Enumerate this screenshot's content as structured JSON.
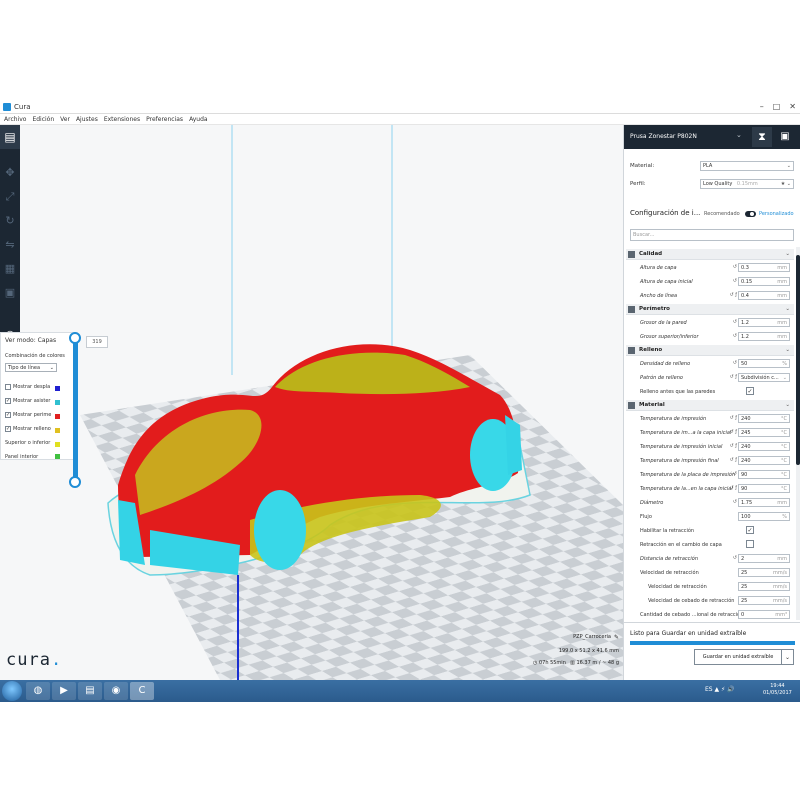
{
  "window": {
    "title": "Cura",
    "controls": [
      "–",
      "□",
      "✕"
    ]
  },
  "menu": [
    "Archivo",
    "Edición",
    "Ver",
    "Ajustes",
    "Extensiones",
    "Preferencias",
    "Ayuda"
  ],
  "view_panel": {
    "mode_label": "Ver modo: Capas",
    "color_scheme_label": "Combinación de colores",
    "color_scheme_value": "Tipo de línea",
    "options": [
      {
        "label": "Mostrar despla",
        "checked": false,
        "color": "#2020d0"
      },
      {
        "label": "Mostrar asister",
        "checked": true,
        "color": "#30c0d0"
      },
      {
        "label": "Mostrar perime",
        "checked": true,
        "color": "#e02020"
      },
      {
        "label": "Mostrar relleno",
        "checked": true,
        "color": "#e0c020"
      },
      {
        "label": "Superior o inferior",
        "checked": null,
        "color": "#e0e020"
      },
      {
        "label": "Panel interior",
        "checked": null,
        "color": "#40c040"
      }
    ],
    "layer_value": "319"
  },
  "sidebar": {
    "printer": "Prusa Zonestar P802N",
    "material_label": "Material:",
    "material_value": "PLA",
    "profile_label": "Perfil:",
    "profile_value": "Low Quality",
    "profile_sub": "0.15mm",
    "config_title": "Configuración de i...",
    "mode_recommended": "Recomendado",
    "mode_custom": "Personalizado",
    "search_placeholder": "Buscar...",
    "ready_text": "Listo para Guardar en unidad extraíble",
    "ready_progress": 1.0,
    "save_button": "Guardar en unidad extraíble",
    "save_dropdown": "⌄"
  },
  "categories": {
    "calidad": "Calidad",
    "perimetro": "Perímetro",
    "relleno": "Relleno",
    "material": "Material"
  },
  "settings": {
    "altura_capa": {
      "label": "Altura de capa",
      "value": "0.3",
      "unit": "mm"
    },
    "altura_capa_inicial": {
      "label": "Altura de capa inicial",
      "value": "0.15",
      "unit": "mm"
    },
    "ancho_linea": {
      "label": "Ancho de línea",
      "value": "0.4",
      "unit": "mm"
    },
    "grosor_pared": {
      "label": "Grosor de la pared",
      "value": "1.2",
      "unit": "mm"
    },
    "grosor_superior": {
      "label": "Grosor superior/inferior",
      "value": "1.2",
      "unit": "mm"
    },
    "densidad_relleno": {
      "label": "Densidad de relleno",
      "value": "50",
      "unit": "%"
    },
    "patron_relleno": {
      "label": "Patrón de relleno",
      "value": "Subdivisión c..."
    },
    "relleno_antes": {
      "label": "Relleno antes que las paredes",
      "checked": true
    },
    "temp_impresion": {
      "label": "Temperatura de impresión",
      "value": "240",
      "unit": "°C"
    },
    "temp_capa_inicial": {
      "label": "Temperatura de im...a la capa inicial",
      "value": "245",
      "unit": "°C"
    },
    "temp_impresion_inicial": {
      "label": "Temperatura de impresión inicial",
      "value": "240",
      "unit": "°C"
    },
    "temp_impresion_final": {
      "label": "Temperatura de impresión final",
      "value": "240",
      "unit": "°C"
    },
    "temp_placa": {
      "label": "Temperatura de la placa de impresión",
      "value": "90",
      "unit": "°C"
    },
    "temp_placa_inicial": {
      "label": "Temperatura de la...en la capa inicial",
      "value": "90",
      "unit": "°C"
    },
    "diametro": {
      "label": "Diámetro",
      "value": "1.75",
      "unit": "mm"
    },
    "flujo": {
      "label": "Flujo",
      "value": "100",
      "unit": "%"
    },
    "habilitar_retraccion": {
      "label": "Habilitar la retracción",
      "checked": true
    },
    "retraccion_cambio": {
      "label": "Retracción en el cambio de capa",
      "checked": false
    },
    "distancia_retraccion": {
      "label": "Distancia de retracción",
      "value": "2",
      "unit": "mm"
    },
    "velocidad_retraccion": {
      "label": "Velocidad de retracción",
      "value": "25",
      "unit": "mm/s"
    },
    "velocidad_retraccion_2": {
      "label": "Velocidad de retracción",
      "value": "25",
      "unit": "mm/s"
    },
    "velocidad_cebado": {
      "label": "Velocidad de cebado de retracción",
      "value": "25",
      "unit": "mm/s"
    },
    "cantidad_cebado": {
      "label": "Cantidad de cebado ...ional de retracción",
      "value": "0",
      "unit": "mm³"
    }
  },
  "job": {
    "name": "PZP_Carroceria",
    "dimensions": "199.0 x 51.2 x 41.6 mm",
    "time": "07h 55min",
    "material": "16.37 m / ~ 48 g"
  },
  "taskbar": {
    "tray": "ES  ▲  ⚡  🔊",
    "time": "19:44",
    "date": "01/05/2017"
  },
  "logo": "cura",
  "colors": {
    "accent": "#1f8dd6",
    "dark": "#1c2733",
    "model_shell": "#e02020",
    "model_infill": "#d0c020",
    "model_support": "#30d0e0"
  }
}
